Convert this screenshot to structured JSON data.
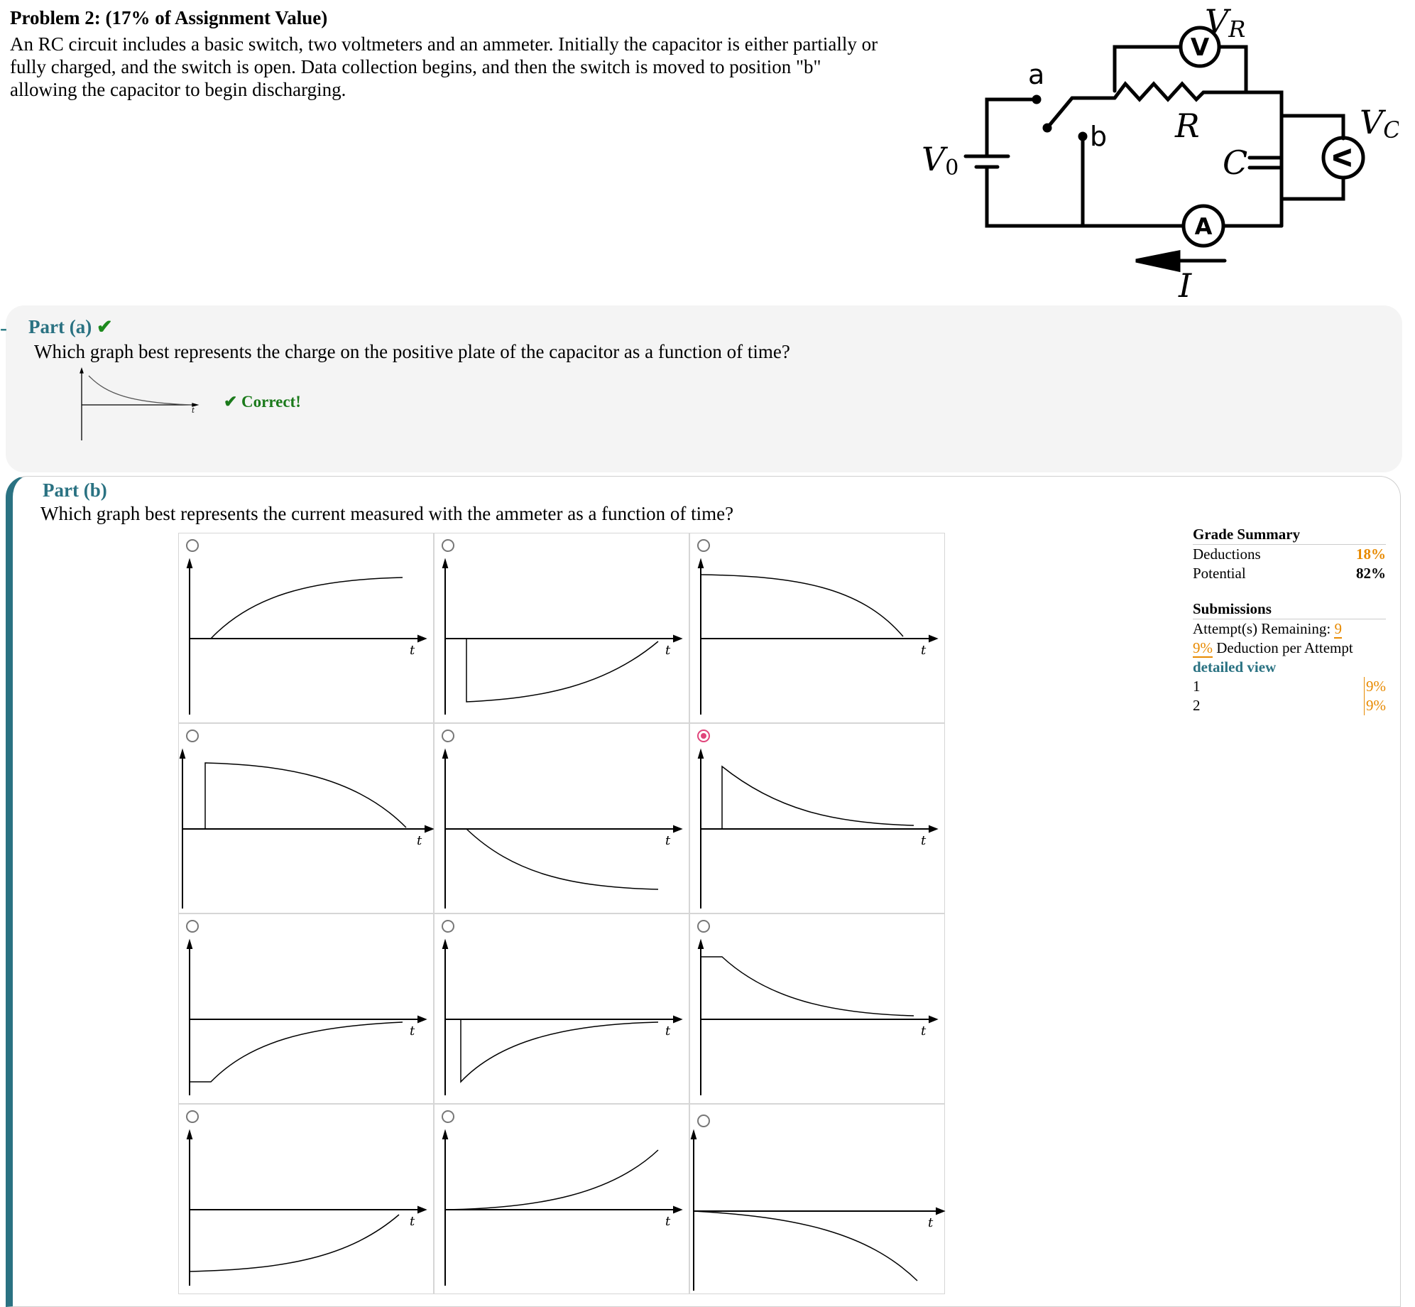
{
  "problem": {
    "title": "Problem 2: (17% of Assignment Value)",
    "text": "An RC circuit includes a basic switch, two voltmeters and an ammeter. Initially the capacitor is either partially or fully charged, and the switch is open. Data collection begins, and then the switch is moved to position \"b\" allowing the capacitor to begin discharging."
  },
  "circuit": {
    "label_vr": "V",
    "label_vr_sub": "R",
    "label_vc": "V",
    "label_vc_sub": "C",
    "label_v0": "V",
    "label_v0_sub": "0",
    "label_r": "R",
    "label_c": "C",
    "label_i": "I",
    "label_a": "a",
    "label_b": "b",
    "voltmeter_symbol": "V",
    "ammeter_symbol": "A"
  },
  "part_a": {
    "collapse": "-",
    "label": "Part (a)",
    "check": "✔",
    "question": "Which graph best represents the charge on the positive plate of the capacitor as a function of time?",
    "feedback": "✔ Correct!",
    "axis_label": "t"
  },
  "part_b": {
    "label": "Part (b)",
    "question": "Which graph best represents the current measured with the ammeter as a function of time?",
    "axis_label": "t",
    "selected_index": 5
  },
  "grade_summary": {
    "title": "Grade Summary",
    "deductions_label": "Deductions",
    "deductions_value": "18%",
    "potential_label": "Potential",
    "potential_value": "82%"
  },
  "submissions": {
    "title": "Submissions",
    "attempts_label": "Attempt(s) Remaining:",
    "attempts_value": "9",
    "deduction_value": "9%",
    "deduction_label": "Deduction per Attempt",
    "detailed_view": "detailed view",
    "rows": [
      {
        "n": "1",
        "pct": "9%"
      },
      {
        "n": "2",
        "pct": "9%"
      }
    ]
  }
}
